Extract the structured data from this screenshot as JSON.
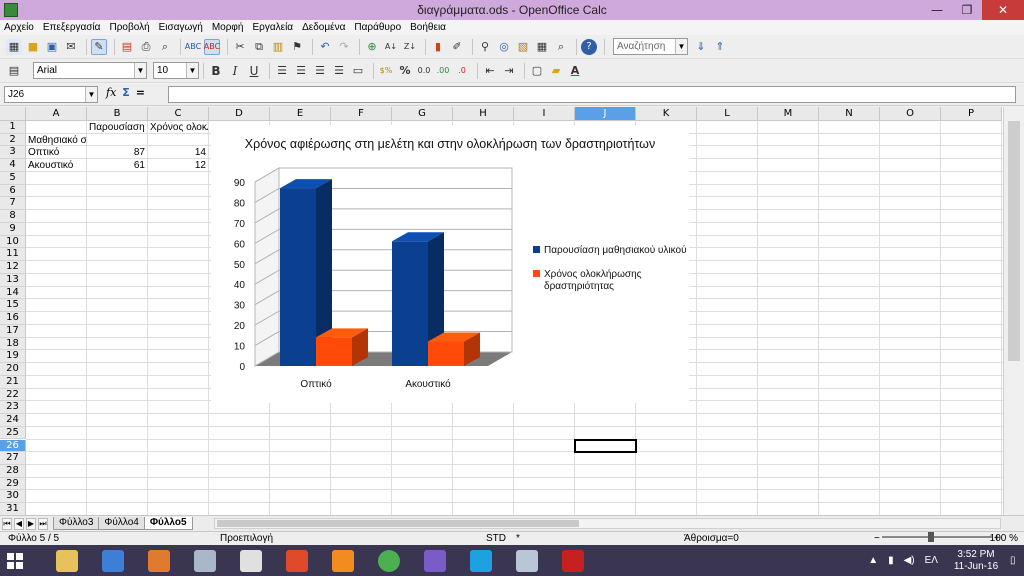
{
  "window": {
    "title": "διαγράμματα.ods - OpenOffice Calc"
  },
  "menu": [
    "Αρχείο",
    "Επεξεργασία",
    "Προβολή",
    "Εισαγωγή",
    "Μορφή",
    "Εργαλεία",
    "Δεδομένα",
    "Παράθυρο",
    "Βοήθεια"
  ],
  "toolbar": {
    "search_value": "Αναζήτηση",
    "font_name": "Arial",
    "font_size": "10",
    "bold": "B",
    "italic": "I",
    "underline": "U",
    "percent": "%",
    "currency": "$%"
  },
  "formula": {
    "name_box": "J26",
    "fx": "fx",
    "sum": "Σ",
    "equals": "=",
    "content": ""
  },
  "grid": {
    "columns": [
      "A",
      "B",
      "C",
      "D",
      "E",
      "F",
      "G",
      "H",
      "I",
      "J",
      "K",
      "L",
      "M",
      "N",
      "O",
      "P"
    ],
    "rows": [
      "1",
      "2",
      "3",
      "4",
      "5",
      "6",
      "7",
      "8",
      "9",
      "10",
      "11",
      "12",
      "13",
      "14",
      "15",
      "16",
      "17",
      "18",
      "19",
      "20",
      "21",
      "22",
      "23",
      "24",
      "25",
      "26",
      "27",
      "28",
      "29",
      "30",
      "31"
    ],
    "active_column": "J",
    "active_row": "26",
    "cells": {
      "B1": "Παρουσίαση μαθησιακού υλικού",
      "C1": "Χρόνος ολοκλήρωσης δραστηριότητας",
      "A2": "Μαθησιακό στιλ",
      "A3": "Οπτικό",
      "B3": "87",
      "C3": "14",
      "A4": "Ακουστικό",
      "B4": "61",
      "C4": "12"
    }
  },
  "chart_data": {
    "type": "bar",
    "title": "Χρόνος αφιέρωσης στη μελέτη και στην ολοκλήρωση των δραστηριοτήτων",
    "categories": [
      "Οπτικό",
      "Ακουστικό"
    ],
    "series": [
      {
        "name": "Παρουσίαση μαθησιακού υλικού",
        "values": [
          87,
          61
        ],
        "color": "#0b3f8f"
      },
      {
        "name": "Χρόνος ολοκλήρωσης δραστηριότητας",
        "values": [
          14,
          12
        ],
        "color": "#ff4a0a"
      }
    ],
    "yticks": [
      "0",
      "10",
      "20",
      "30",
      "40",
      "50",
      "60",
      "70",
      "80",
      "90"
    ],
    "ylim": [
      0,
      90
    ],
    "grid": true,
    "legend": "right",
    "three_d": true,
    "legend_lines": [
      [
        "Παρουσίαση μαθησιακού υλικού"
      ],
      [
        "Χρόνος ολοκλήρωσης",
        "δραστηριότητας"
      ]
    ]
  },
  "sheets": {
    "tabs": [
      "Φύλλο3",
      "Φύλλο4",
      "Φύλλο5"
    ],
    "active": "Φύλλο5"
  },
  "status": {
    "sheet": "Φύλλο 5 / 5",
    "style": "Προεπιλογή",
    "mode": "STD",
    "star": "*",
    "sum": "Άθροισμα=0",
    "zoom": "100 %",
    "zoom_minus": "−",
    "zoom_plus": "+"
  },
  "taskbar": {
    "language": "ΕΛ",
    "time": "3:52 PM",
    "date": "11-Jun-16",
    "apps": [
      {
        "name": "file-explorer-icon",
        "color": "#e7c25a"
      },
      {
        "name": "scanner-icon",
        "color": "#3c7fd6"
      },
      {
        "name": "office-icon",
        "color": "#e07a2f"
      },
      {
        "name": "files-icon",
        "color": "#a9b7c8"
      },
      {
        "name": "pdf-tools-icon",
        "color": "#e0e0e0"
      },
      {
        "name": "ccleaner-icon",
        "color": "#e04a2a"
      },
      {
        "name": "avast-icon",
        "color": "#f28c1e"
      },
      {
        "name": "chrome-icon",
        "color": "#4caf50"
      },
      {
        "name": "viber-icon",
        "color": "#7b5cc7"
      },
      {
        "name": "skype-icon",
        "color": "#1ea1e0"
      },
      {
        "name": "openoffice-icon",
        "color": "#b8c6d6"
      },
      {
        "name": "acrobat-icon",
        "color": "#c62020"
      }
    ]
  }
}
